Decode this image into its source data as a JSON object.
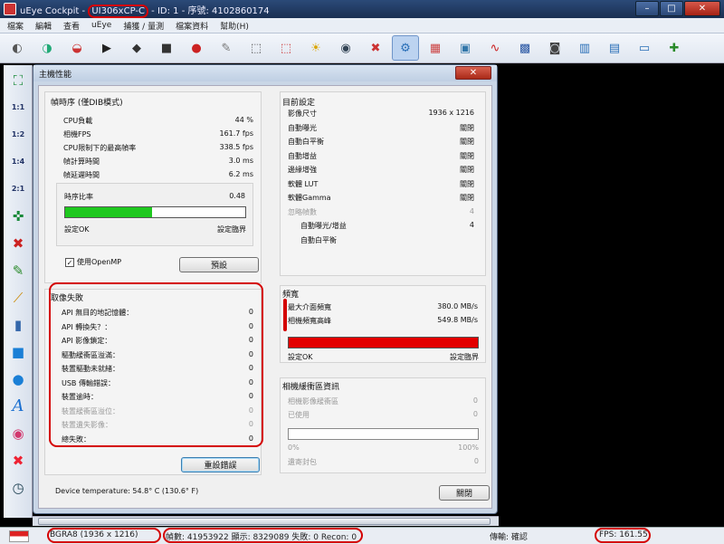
{
  "window": {
    "app_name": "uEye Cockpit",
    "model": "UI306xCP-C",
    "id_text": "ID: 1 - 序號: 4102860174",
    "sep": " - "
  },
  "menu": [
    "檔案",
    "編輯",
    "查看",
    "uEye",
    "捕獲 / 量測",
    "檔案資料",
    "幫助(H)"
  ],
  "toolbar_icons": [
    "camera-open-icon",
    "camera-add-icon",
    "camera-remove-icon",
    "live-film-icon",
    "snapshot-film-icon",
    "stop-film-icon",
    "film-record-icon",
    "wrench-icon",
    "aoi-icon",
    "aoi-clear-icon",
    "auto-exposure-icon",
    "auto-white-balance-icon",
    "aoi-delete-icon",
    "camera-settings-icon",
    "hotpixel-icon",
    "color-icon",
    "curve-icon",
    "save-icon",
    "video-camera-icon",
    "histogram-icon",
    "zoom-window-icon",
    "line-view-icon",
    "zoom-plus-icon"
  ],
  "left_tools": [
    {
      "icon": "fit-window-icon",
      "text": ""
    },
    {
      "icon": "zoom-1-1-icon",
      "text": "1:1"
    },
    {
      "icon": "zoom-1-2-icon",
      "text": "1:2"
    },
    {
      "icon": "zoom-1-4-icon",
      "text": "1:4"
    },
    {
      "icon": "zoom-2-1-icon",
      "text": "2:1"
    },
    {
      "icon": "crosshair-icon",
      "text": ""
    },
    {
      "icon": "close-view-icon",
      "text": ""
    },
    {
      "icon": "pencil-icon",
      "text": ""
    },
    {
      "icon": "polyline-icon",
      "text": ""
    },
    {
      "icon": "ruler-icon",
      "text": ""
    },
    {
      "icon": "rectangle-icon",
      "text": ""
    },
    {
      "icon": "ellipse-icon",
      "text": ""
    },
    {
      "icon": "text-icon",
      "text": "A"
    },
    {
      "icon": "color-wheel-icon",
      "text": ""
    },
    {
      "icon": "delete-icon",
      "text": ""
    },
    {
      "icon": "clock-icon",
      "text": ""
    }
  ],
  "dialog": {
    "title": "主機性能",
    "timing": {
      "title": "幀時序 (僅DIB模式)",
      "rows": [
        {
          "label": "CPU負載",
          "value": "44 %"
        },
        {
          "label": "相機FPS",
          "value": "161.7 fps"
        },
        {
          "label": "CPU限制下的最高幀率",
          "value": "338.5 fps"
        },
        {
          "label": "幀計算時間",
          "value": "3.0 ms"
        },
        {
          "label": "幀延遲時間",
          "value": "6.2 ms"
        }
      ],
      "ratio_label": "時序比率",
      "ratio_value": "0.48",
      "ratio": 0.48,
      "ok_label": "設定OK",
      "limit_label": "設定臨界",
      "openmp_label": "使用OpenMP",
      "preset_button": "預設"
    },
    "current_settings": {
      "title": "目前設定",
      "rows": [
        {
          "label": "影像尺寸",
          "value": "1936 x 1216",
          "gray": false,
          "indent": false
        },
        {
          "label": "自動曝光",
          "value": "關閉",
          "gray": false,
          "indent": false
        },
        {
          "label": "自動白平衡",
          "value": "關閉",
          "gray": false,
          "indent": false
        },
        {
          "label": "自動增益",
          "value": "關閉",
          "gray": false,
          "indent": false
        },
        {
          "label": "邊緣增強",
          "value": "關閉",
          "gray": false,
          "indent": false
        },
        {
          "label": "軟體 LUT",
          "value": "關閉",
          "gray": false,
          "indent": false
        },
        {
          "label": "軟體Gamma",
          "value": "關閉",
          "gray": false,
          "indent": false
        },
        {
          "label": "忽略幀數",
          "value": "4",
          "gray": true,
          "indent": false
        },
        {
          "label": "自動曝光/增益",
          "value": "4",
          "gray": false,
          "indent": true
        },
        {
          "label": "自動白平衡",
          "value": "",
          "gray": false,
          "indent": true
        }
      ]
    },
    "capture_errors": {
      "title": "取像失敗",
      "rows": [
        {
          "label": "API 無目的地記憶體：",
          "value": "0",
          "gray": false
        },
        {
          "label": "API 轉換失？：",
          "value": "0",
          "gray": false
        },
        {
          "label": "API 影像鎖定：",
          "value": "0",
          "gray": false
        },
        {
          "label": "驅動緩衝區溢滿：",
          "value": "0",
          "gray": false
        },
        {
          "label": "裝置驅動未就緒：",
          "value": "0",
          "gray": false
        },
        {
          "label": "USB 傳輸錯誤：",
          "value": "0",
          "gray": false
        },
        {
          "label": "裝置逾時：",
          "value": "0",
          "gray": false
        },
        {
          "label": "裝置緩衝區溢位：",
          "value": "0",
          "gray": true
        },
        {
          "label": "裝置遺失影像：",
          "value": "0",
          "gray": true
        },
        {
          "label": "總失敗：",
          "value": "0",
          "gray": false
        }
      ],
      "reset_button": "重設錯誤"
    },
    "bandwidth": {
      "title": "頻寬",
      "rows": [
        {
          "label": "最大介面頻寬",
          "value": "380.0 MB/s"
        },
        {
          "label": "相機頻寬高峰",
          "value": "549.8 MB/s"
        }
      ],
      "ratio": 1.0,
      "ok_label": "設定OK",
      "limit_label": "設定臨界"
    },
    "camera_buffer": {
      "title": "相機緩衝區資訊",
      "rows": [
        {
          "label": "相機影像緩衝區",
          "value": "0"
        },
        {
          "label": "已使用",
          "value": "0"
        }
      ],
      "bar_min": "0%",
      "bar_max": "100%",
      "lost_label": "遺寄封包",
      "lost_value": "0"
    },
    "temperature": "Device temperature:  54.8° C (130.6° F)",
    "close_button": "關閉"
  },
  "statusbar": {
    "format": "BGRA8 (1936 x 1216)",
    "counters": "幀數: 41953922 顯示: 8329089 失敗: 0   Recon: 0",
    "transfer": "傳輸: 確認",
    "fps": "FPS: 161.55"
  },
  "colors": {
    "timing_bar": "#1ec81e",
    "bandwidth_bar": "#e30000",
    "highlight": "#d40000"
  }
}
